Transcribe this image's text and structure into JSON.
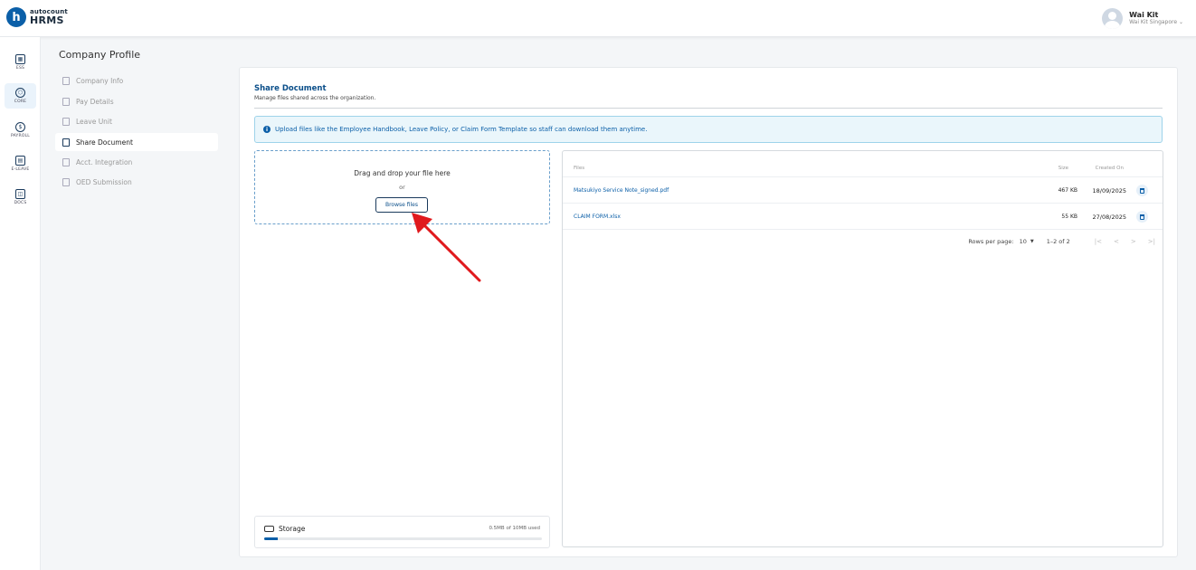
{
  "header": {
    "logo_mark": "h",
    "logo_top": "autocount",
    "logo_bottom": "HRMS",
    "user_name": "Wai Kit",
    "user_company": "Wai Kit Singapore ⌄"
  },
  "rail": {
    "items": [
      {
        "label": "ESS",
        "icon": "ess-icon"
      },
      {
        "label": "CORE",
        "icon": "core-icon"
      },
      {
        "label": "PAYROLL",
        "icon": "payroll-icon"
      },
      {
        "label": "E-LEAVE",
        "icon": "calendar-icon"
      },
      {
        "label": "DOCS",
        "icon": "docs-icon"
      }
    ],
    "active": "CORE"
  },
  "section": {
    "title": "Company Profile",
    "items": [
      {
        "label": "Company Info"
      },
      {
        "label": "Pay Details"
      },
      {
        "label": "Leave Unit"
      },
      {
        "label": "Share Document"
      },
      {
        "label": "Acct. Integration"
      },
      {
        "label": "OED Submission"
      }
    ],
    "active": "Share Document"
  },
  "main": {
    "title": "Share Document",
    "subtitle": "Manage files shared across the organization.",
    "info_text": "Upload files like the Employee Handbook, Leave Policy, or Claim Form Template so staff can download them anytime.",
    "dropzone": {
      "title": "Drag and drop your file here",
      "or": "or",
      "button": "Browse files"
    },
    "storage": {
      "label": "Storage",
      "used_text": "0.5MB of 10MB used",
      "used_fraction": 0.05
    },
    "table": {
      "headers": {
        "files": "Files",
        "size": "Size",
        "created": "Created On"
      },
      "rows": [
        {
          "name": "Matsukiyo Service Note_signed.pdf",
          "size": "467 KB",
          "created": "18/09/2025"
        },
        {
          "name": "CLAIM FORM.xlsx",
          "size": "55 KB",
          "created": "27/08/2025"
        }
      ],
      "pager": {
        "rows_per_page_label": "Rows per page:",
        "rows_per_page": "10",
        "range": "1–2 of 2"
      }
    }
  },
  "colors": {
    "brand": "#0b5fa8",
    "annotation_arrow": "#e0191d"
  }
}
